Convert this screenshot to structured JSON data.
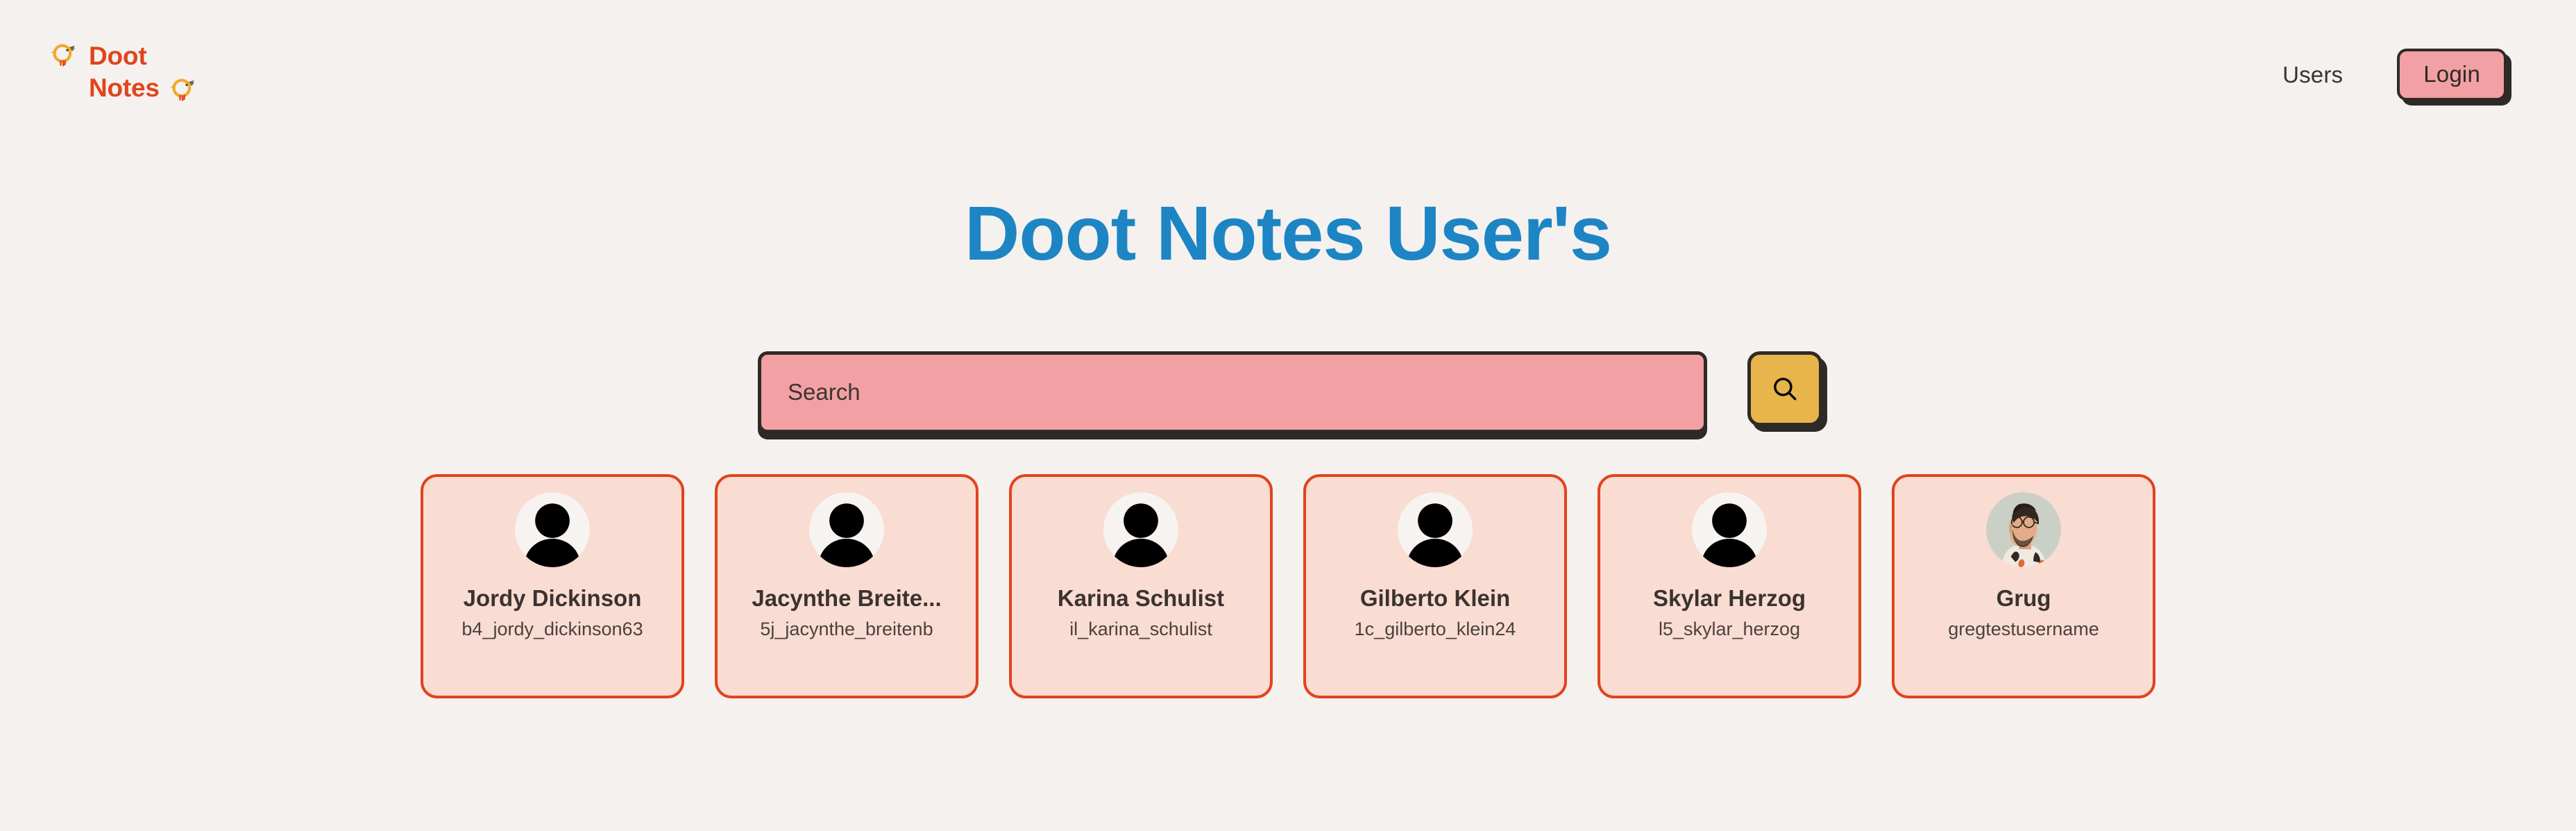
{
  "header": {
    "brand": {
      "word1": "Doot",
      "word2": "Notes",
      "icon_left": "bird-icon",
      "icon_right": "bird-icon"
    },
    "nav": {
      "users_label": "Users",
      "login_label": "Login"
    }
  },
  "main": {
    "title": "Doot Notes User's",
    "search": {
      "placeholder": "Search",
      "value": "",
      "button_icon": "search-icon"
    },
    "users": [
      {
        "name": "Jordy Dickinson",
        "username": "b4_jordy_dickinson63",
        "avatar_type": "default-silhouette"
      },
      {
        "name": "Jacynthe Breite...",
        "username": "5j_jacynthe_breitenb",
        "avatar_type": "default-silhouette"
      },
      {
        "name": "Karina Schulist",
        "username": "il_karina_schulist",
        "avatar_type": "default-silhouette"
      },
      {
        "name": "Gilberto Klein",
        "username": "1c_gilberto_klein24",
        "avatar_type": "default-silhouette"
      },
      {
        "name": "Skylar Herzog",
        "username": "l5_skylar_herzog",
        "avatar_type": "default-silhouette"
      },
      {
        "name": "Grug",
        "username": "gregtestusername",
        "avatar_type": "photo"
      }
    ]
  },
  "colors": {
    "background": "#f5f1ee",
    "brand_orange": "#e0441d",
    "title_blue": "#1d85c4",
    "pink": "#f2a0a3",
    "amber": "#e8b44c",
    "card_bg": "#f9dcd2",
    "dark": "#2e2a26"
  }
}
